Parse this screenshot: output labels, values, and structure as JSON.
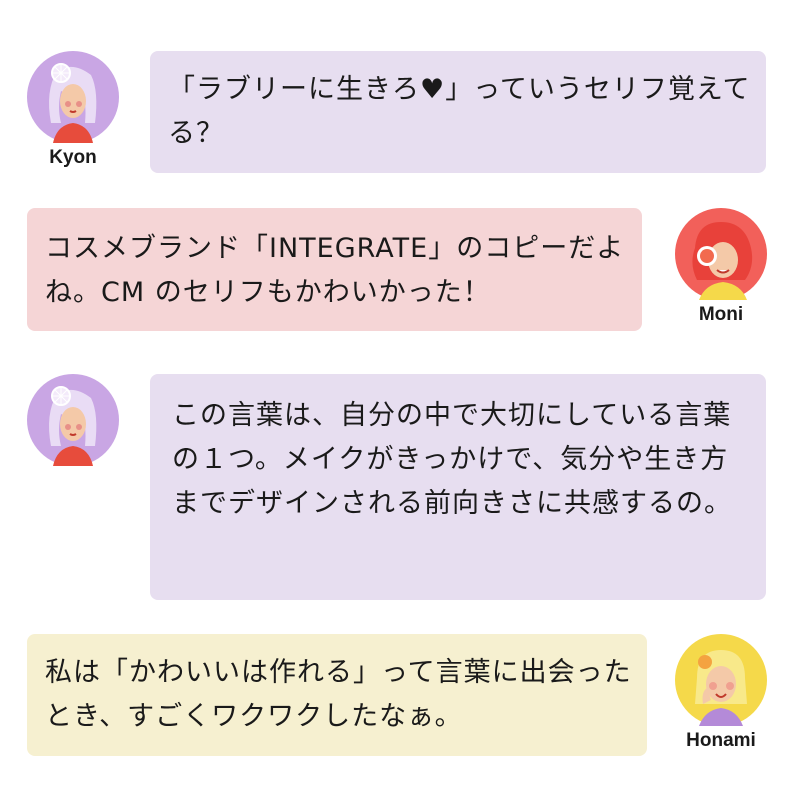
{
  "messages": [
    {
      "speaker": "Kyon",
      "text": "「ラブリーに生きろ♥」っていうセリフ覚えてる？"
    },
    {
      "speaker": "Moni",
      "text": "コスメブランド「INTEGRATE」のコピーだよね。CM のセリフもかわいかった！"
    },
    {
      "speaker": "Kyon",
      "text": "この言葉は、自分の中で大切にしている言葉の１つ。メイクがきっかけで、気分や生き方までデザインされる前向きさに共感するの。"
    },
    {
      "speaker": "Honami",
      "text": "私は「かわいいは作れる」って言葉に出会ったとき、すごくワクワクしたなぁ。"
    }
  ],
  "colors": {
    "kyon_bubble": "#e7def0",
    "moni_bubble": "#f5d5d6",
    "honami_bubble": "#f6f0d0",
    "kyon_avatar": "#c9a6e4",
    "moni_avatar": "#f2605a",
    "honami_avatar": "#f5d94a"
  },
  "icons": [
    "kyon-avatar-icon",
    "moni-avatar-icon",
    "honami-avatar-icon"
  ]
}
